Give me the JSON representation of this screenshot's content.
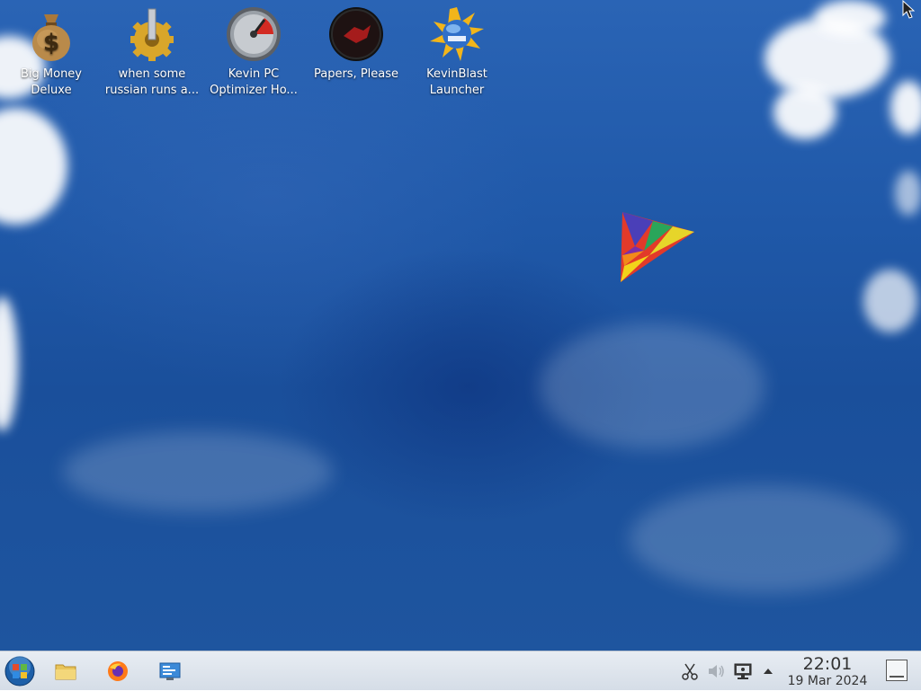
{
  "desktop": {
    "icons": [
      {
        "label": "Big Money Deluxe",
        "line1": "Big Money",
        "line2": "Deluxe",
        "icon": "money-bag-icon"
      },
      {
        "label": "when some russian runs a...",
        "line1": "when some",
        "line2": "russian runs a...",
        "icon": "gear-icon"
      },
      {
        "label": "Kevin PC Optimizer Ho...",
        "line1": "Kevin PC",
        "line2": "Optimizer Ho...",
        "icon": "speedometer-icon"
      },
      {
        "label": "Papers, Please",
        "line1": "Papers, Please",
        "line2": "",
        "icon": "papers-please-icon"
      },
      {
        "label": "KevinBlast Launcher",
        "line1": "KevinBlast",
        "line2": "Launcher",
        "icon": "starburst-globe-icon"
      }
    ]
  },
  "taskbar": {
    "start_icon": "start-orb-icon",
    "pinned": [
      "file-manager-icon",
      "firefox-icon",
      "system-settings-icon"
    ],
    "tray": [
      "scissors-icon",
      "volume-muted-icon",
      "network-monitor-icon",
      "tray-expand-arrow-icon"
    ],
    "clock": {
      "time": "22:01",
      "date": "19 Mar 2024"
    }
  },
  "colors": {
    "sky": "#1f58a8",
    "taskbar": "#dde3ea",
    "label": "#ffffff"
  }
}
